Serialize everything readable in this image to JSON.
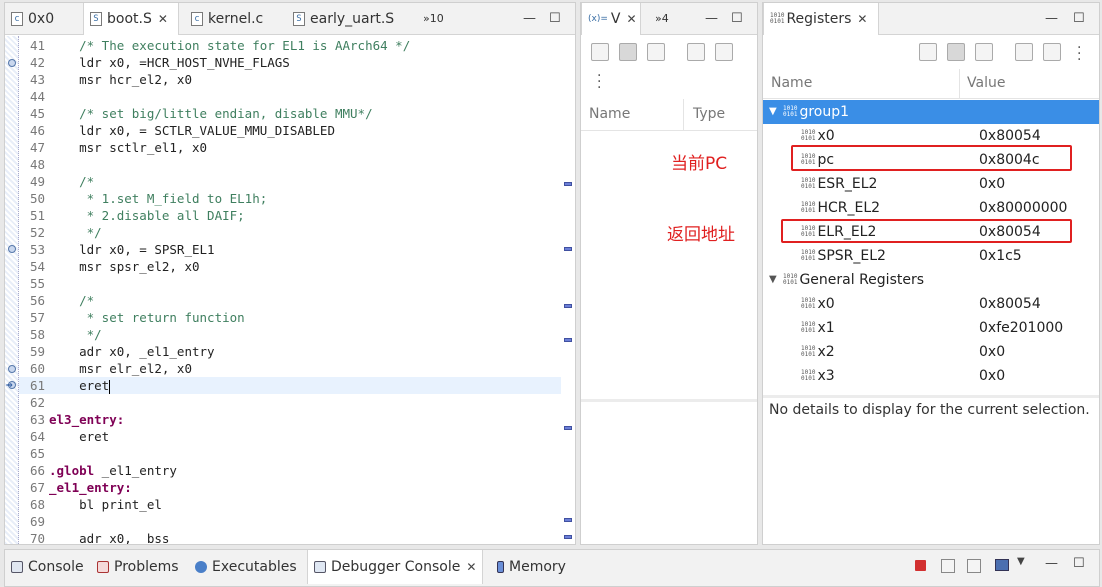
{
  "editor": {
    "tabs": [
      {
        "label": "0x0",
        "icon": "c-file-icon"
      },
      {
        "label": "boot.S",
        "icon": "asm-file-icon",
        "active": true
      },
      {
        "label": "kernel.c",
        "icon": "c-file-icon"
      },
      {
        "label": "early_uart.S",
        "icon": "asm-file-icon"
      }
    ],
    "overflow": "»10",
    "lines": [
      {
        "n": "41",
        "code": "    /* The execution state for EL1 is AArch64 */",
        "cls": "cm"
      },
      {
        "n": "42",
        "code": "    ldr x0, =HCR_HOST_NVHE_FLAGS",
        "cls": ""
      },
      {
        "n": "43",
        "code": "    msr hcr_el2, x0",
        "cls": ""
      },
      {
        "n": "44",
        "code": "",
        "cls": ""
      },
      {
        "n": "45",
        "code": "    /* set big/little endian, disable MMU*/",
        "cls": "cm"
      },
      {
        "n": "46",
        "code": "    ldr x0, = SCTLR_VALUE_MMU_DISABLED",
        "cls": ""
      },
      {
        "n": "47",
        "code": "    msr sctlr_el1, x0",
        "cls": ""
      },
      {
        "n": "48",
        "code": "",
        "cls": ""
      },
      {
        "n": "49",
        "code": "    /*",
        "cls": "cm"
      },
      {
        "n": "50",
        "code": "     * 1.set M_field to EL1h;",
        "cls": "cm"
      },
      {
        "n": "51",
        "code": "     * 2.disable all DAIF;",
        "cls": "cm"
      },
      {
        "n": "52",
        "code": "     */",
        "cls": "cm"
      },
      {
        "n": "53",
        "code": "    ldr x0, = SPSR_EL1",
        "cls": ""
      },
      {
        "n": "54",
        "code": "    msr spsr_el2, x0",
        "cls": ""
      },
      {
        "n": "55",
        "code": "",
        "cls": ""
      },
      {
        "n": "56",
        "code": "    /*",
        "cls": "cm"
      },
      {
        "n": "57",
        "code": "     * set return function",
        "cls": "cm"
      },
      {
        "n": "58",
        "code": "     */",
        "cls": "cm"
      },
      {
        "n": "59",
        "code": "    adr x0, _el1_entry",
        "cls": ""
      },
      {
        "n": "60",
        "code": "    msr elr_el2, x0",
        "cls": ""
      },
      {
        "n": "61",
        "code": "    eret",
        "cls": "",
        "current": true
      },
      {
        "n": "62",
        "code": "",
        "cls": ""
      },
      {
        "n": "63",
        "code": "el3_entry:",
        "cls": "kw"
      },
      {
        "n": "64",
        "code": "    eret",
        "cls": ""
      },
      {
        "n": "65",
        "code": "",
        "cls": ""
      },
      {
        "n": "66",
        "code": ".globl _el1_entry",
        "cls": "glob"
      },
      {
        "n": "67",
        "code": "_el1_entry:",
        "cls": "kw"
      },
      {
        "n": "68",
        "code": "    bl print_el",
        "cls": ""
      },
      {
        "n": "69",
        "code": "",
        "cls": ""
      },
      {
        "n": "70",
        "code": "    adr x0, _bss",
        "cls": ""
      }
    ]
  },
  "variables": {
    "tab_label": "V",
    "tab_prefix": "(x)=",
    "overflow": "»4",
    "col_name": "Name",
    "col_type": "Type"
  },
  "annotations": {
    "current_pc": "当前PC",
    "return_address": "返回地址",
    "color": "#e02020"
  },
  "registers": {
    "tab_label": "Registers",
    "col_name": "Name",
    "col_value": "Value",
    "rows": [
      {
        "name": "group1",
        "value": "",
        "level": 0,
        "group": true,
        "selected": true
      },
      {
        "name": "x0",
        "value": "0x80054",
        "level": 1
      },
      {
        "name": "pc",
        "value": "0x8004c",
        "level": 1,
        "boxed": true
      },
      {
        "name": "ESR_EL2",
        "value": "0x0",
        "level": 1
      },
      {
        "name": "HCR_EL2",
        "value": "0x80000000",
        "level": 1
      },
      {
        "name": "ELR_EL2",
        "value": "0x80054",
        "level": 1,
        "boxed": true
      },
      {
        "name": "SPSR_EL2",
        "value": "0x1c5",
        "level": 1
      },
      {
        "name": "General Registers",
        "value": "",
        "level": 0,
        "group": true
      },
      {
        "name": "x0",
        "value": "0x80054",
        "level": 1
      },
      {
        "name": "x1",
        "value": "0xfe201000",
        "level": 1
      },
      {
        "name": "x2",
        "value": "0x0",
        "level": 1
      },
      {
        "name": "x3",
        "value": "0x0",
        "level": 1
      }
    ],
    "details": "No details to display for the current selection."
  },
  "bottom": {
    "tabs": [
      {
        "label": "Console",
        "icon": "console-icon"
      },
      {
        "label": "Problems",
        "icon": "problems-icon"
      },
      {
        "label": "Executables",
        "icon": "executables-icon"
      },
      {
        "label": "Debugger Console",
        "icon": "debugger-console-icon",
        "active": true
      },
      {
        "label": "Memory",
        "icon": "memory-icon"
      }
    ]
  },
  "colors": {
    "selection": "#3a8ee6",
    "comment": "#3f7f5f",
    "keyword": "#7f0055"
  }
}
